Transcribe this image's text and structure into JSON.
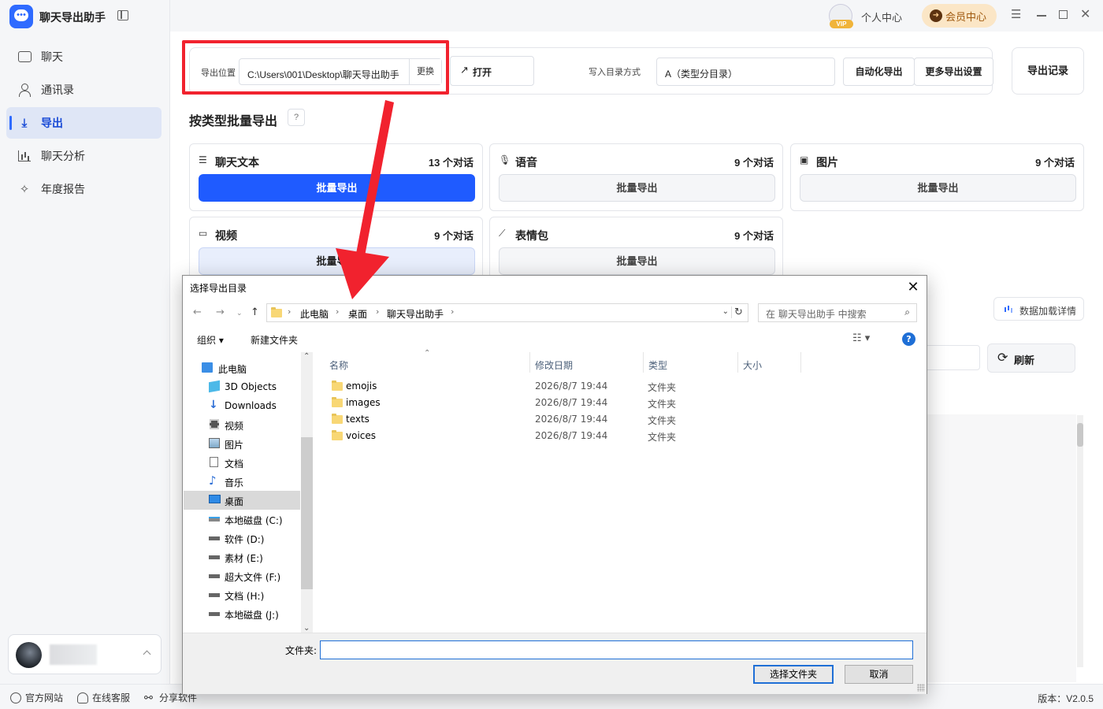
{
  "app": {
    "name": "聊天导出助手",
    "personal_center": "个人中心",
    "vip_badge": "VIP",
    "member_center": "会员中心",
    "version": "版本：V2.0.5"
  },
  "sidebar": {
    "items": [
      {
        "label": "聊天",
        "icon": "chat-icon"
      },
      {
        "label": "通讯录",
        "icon": "contacts-icon"
      },
      {
        "label": "导出",
        "icon": "export-icon",
        "active": true
      },
      {
        "label": "聊天分析",
        "icon": "bar-chart-icon"
      },
      {
        "label": "年度报告",
        "icon": "sparkle-icon"
      }
    ]
  },
  "footer": {
    "website": "官方网站",
    "support": "在线客服",
    "share": "分享软件"
  },
  "toolbar": {
    "export_location_label": "导出位置",
    "path_value": "C:\\Users\\001\\Desktop\\聊天导出助手",
    "change_label": "更换",
    "open_label": "打开",
    "write_mode_label": "写入目录方式",
    "write_mode_value": "A（类型分目录）",
    "auto_export_label": "自动化导出",
    "more_settings_label": "更多导出设置",
    "history_label": "导出记录"
  },
  "section": {
    "title": "按类型批量导出",
    "help": "?"
  },
  "cards": [
    {
      "title": "聊天文本",
      "count": "13 个对话",
      "button": "批量导出",
      "icon": "text-doc-icon"
    },
    {
      "title": "语音",
      "count": "9 个对话",
      "button": "批量导出",
      "icon": "microphone-icon"
    },
    {
      "title": "图片",
      "count": "9 个对话",
      "button": "批量导出",
      "icon": "image-icon"
    },
    {
      "title": "视频",
      "count": "9 个对话",
      "button": "批量导出",
      "icon": "video-icon"
    },
    {
      "title": "表情包",
      "count": "9 个对话",
      "button": "批量导出",
      "icon": "magic-wand-icon"
    }
  ],
  "right": {
    "data_detail": "数据加载详情",
    "refresh": "刷新"
  },
  "dialog": {
    "title": "选择导出目录",
    "breadcrumb": [
      "此电脑",
      "桌面",
      "聊天导出助手"
    ],
    "search_placeholder": "在 聊天导出助手 中搜索",
    "organize": "组织 ▾",
    "new_folder": "新建文件夹",
    "columns": {
      "name": "名称",
      "modified": "修改日期",
      "type": "类型",
      "size": "大小"
    },
    "tree": [
      {
        "label": "此电脑",
        "icon": "computer-icon"
      },
      {
        "label": "3D Objects",
        "icon": "cube-icon"
      },
      {
        "label": "Downloads",
        "icon": "download-arrow-icon"
      },
      {
        "label": "视频",
        "icon": "film-icon"
      },
      {
        "label": "图片",
        "icon": "picture-icon"
      },
      {
        "label": "文档",
        "icon": "document-icon"
      },
      {
        "label": "音乐",
        "icon": "music-note-icon"
      },
      {
        "label": "桌面",
        "icon": "desktop-icon",
        "selected": true
      },
      {
        "label": "本地磁盘 (C:)",
        "icon": "drive-icon"
      },
      {
        "label": "软件 (D:)",
        "icon": "drive-icon"
      },
      {
        "label": "素材 (E:)",
        "icon": "drive-icon"
      },
      {
        "label": "超大文件 (F:)",
        "icon": "drive-icon"
      },
      {
        "label": "文档 (H:)",
        "icon": "drive-icon"
      },
      {
        "label": "本地磁盘 (J:)",
        "icon": "drive-icon"
      }
    ],
    "files": [
      {
        "name": "emojis",
        "date": "2026/8/7 19:44",
        "type": "文件夹"
      },
      {
        "name": "images",
        "date": "2026/8/7 19:44",
        "type": "文件夹"
      },
      {
        "name": "texts",
        "date": "2026/8/7 19:44",
        "type": "文件夹"
      },
      {
        "name": "voices",
        "date": "2026/8/7 19:44",
        "type": "文件夹"
      }
    ],
    "folder_label": "文件夹:",
    "folder_value": "",
    "select_button": "选择文件夹",
    "cancel_button": "取消"
  },
  "colors": {
    "accent": "#1f5bff",
    "highlight_red": "#f1222e",
    "member_bg": "#fbe6c6"
  }
}
